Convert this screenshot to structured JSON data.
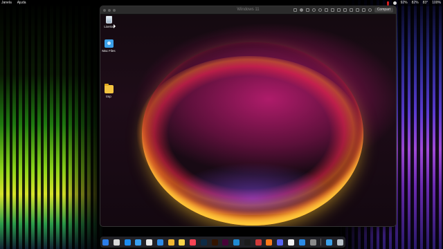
{
  "menubar": {
    "app_menus": [
      "Janela",
      "Ajuda"
    ],
    "status": {
      "battery_1": "92%",
      "battery_2": "82%",
      "temperature": "83°",
      "zoom": "100%"
    }
  },
  "vm_window": {
    "title": "Windows 11",
    "share_label": "Compart"
  },
  "desktop_icons": [
    {
      "label": "Lixeira",
      "icon": "recycle-bin-icon"
    },
    {
      "label": "Mac Files",
      "icon": "mac-files-icon"
    },
    {
      "label": "tmp",
      "icon": "folder-icon"
    }
  ],
  "dock": {
    "apps": [
      {
        "icon": "finder-icon",
        "color": "#2b7de9"
      },
      {
        "icon": "launchpad-icon",
        "color": "#d9d9d9"
      },
      {
        "icon": "app-store-icon",
        "color": "#1c8cf0"
      },
      {
        "icon": "safari-icon",
        "color": "#3aa0f0"
      },
      {
        "icon": "chrome-icon",
        "color": "#e8e8e8"
      },
      {
        "icon": "mail-icon",
        "color": "#2e8be6"
      },
      {
        "icon": "photos-icon",
        "color": "#f2b733"
      },
      {
        "icon": "notes-icon",
        "color": "#f7d34a"
      },
      {
        "icon": "music-icon",
        "color": "#fa4455"
      },
      {
        "icon": "photoshop-icon",
        "color": "#0e2a44"
      },
      {
        "icon": "illustrator-icon",
        "color": "#321300"
      },
      {
        "icon": "xd-icon",
        "color": "#470137"
      },
      {
        "icon": "vscode-icon",
        "color": "#1f8ad2"
      },
      {
        "icon": "terminal-icon",
        "color": "#1b1b1b"
      },
      {
        "icon": "parallels-icon",
        "color": "#d03a3a"
      },
      {
        "icon": "firefox-icon",
        "color": "#ff7a1a"
      },
      {
        "icon": "discord-icon",
        "color": "#5865f2"
      },
      {
        "icon": "github-icon",
        "color": "#f0f0f0"
      },
      {
        "icon": "windows-icon",
        "color": "#2b8ae6"
      },
      {
        "icon": "settings-icon",
        "color": "#8a8a8a"
      },
      {
        "icon": "folder-icon",
        "color": "#3ba0e8"
      },
      {
        "icon": "trash-icon",
        "color": "#b8c0c8"
      }
    ]
  }
}
